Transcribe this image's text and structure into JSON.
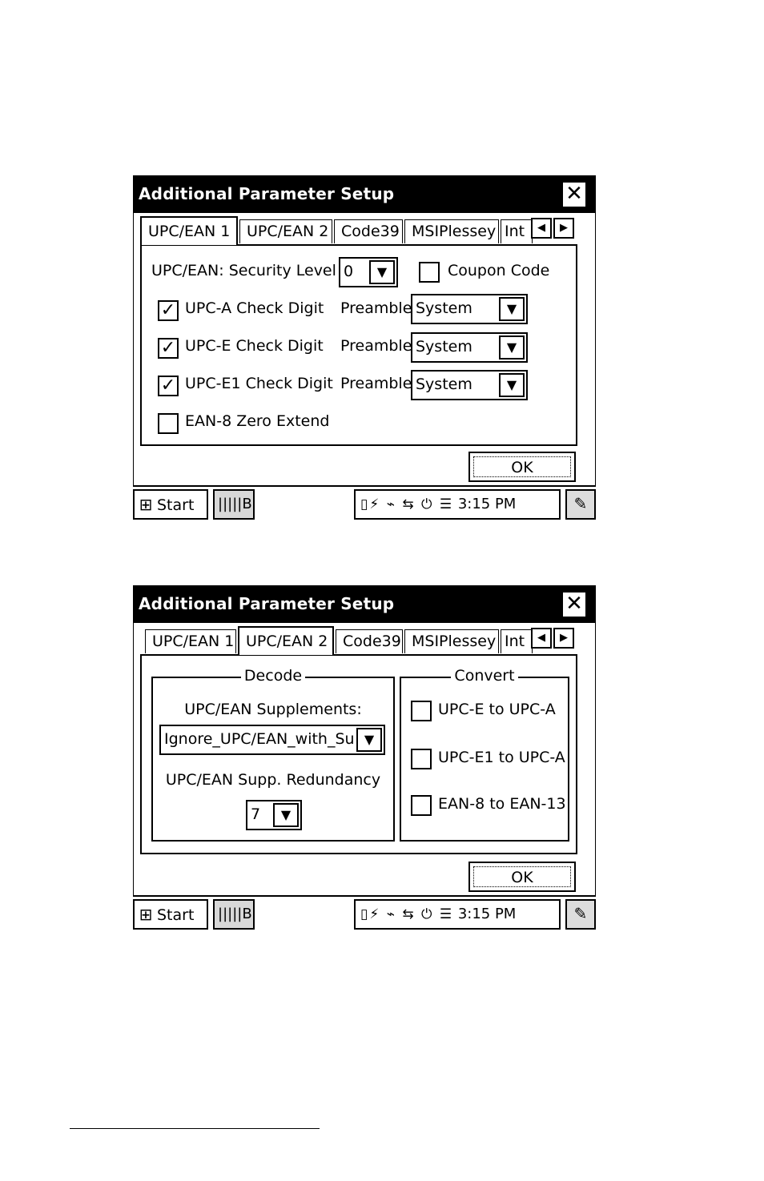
{
  "screen1": {
    "title": "Additional Parameter Setup",
    "close_icon": "close-icon",
    "tabs": [
      "UPC/EAN 1",
      "UPC/EAN 2",
      "Code39",
      "MSIPlessey",
      "Int"
    ],
    "active_tab": "UPC/EAN 1",
    "security_level_label": "UPC/EAN: Security Level",
    "security_level_value": "0",
    "coupon_code_label": "Coupon Code",
    "coupon_code_checked": false,
    "rows": [
      {
        "label": "UPC-A Check Digit",
        "checked": true,
        "preamble_label": "Preamble",
        "preamble_value": "System"
      },
      {
        "label": "UPC-E Check Digit",
        "checked": true,
        "preamble_label": "Preamble",
        "preamble_value": "System"
      },
      {
        "label": "UPC-E1 Check Digit",
        "checked": true,
        "preamble_label": "Preamble",
        "preamble_value": "System"
      }
    ],
    "ean8_label": "EAN-8 Zero Extend",
    "ean8_checked": false,
    "ok_label": "OK",
    "taskbar": {
      "start_label": "Start",
      "app_label": "B",
      "time": "3:15 PM"
    }
  },
  "screen2": {
    "title": "Additional Parameter Setup",
    "tabs": [
      "UPC/EAN 1",
      "UPC/EAN 2",
      "Code39",
      "MSIPlessey",
      "Int"
    ],
    "active_tab": "UPC/EAN 2",
    "decode_title": "Decode",
    "supplements_label": "UPC/EAN Supplements:",
    "supplements_value": "Ignore_UPC/EAN_with_Sup",
    "redundancy_label": "UPC/EAN Supp. Redundancy",
    "redundancy_value": "7",
    "convert_title": "Convert",
    "convert_options": [
      {
        "label": "UPC-E to UPC-A",
        "checked": false
      },
      {
        "label": "UPC-E1 to UPC-A",
        "checked": false
      },
      {
        "label": "EAN-8 to EAN-13",
        "checked": false
      }
    ],
    "ok_label": "OK",
    "taskbar": {
      "start_label": "Start",
      "app_label": "B",
      "time": "3:15 PM"
    }
  }
}
